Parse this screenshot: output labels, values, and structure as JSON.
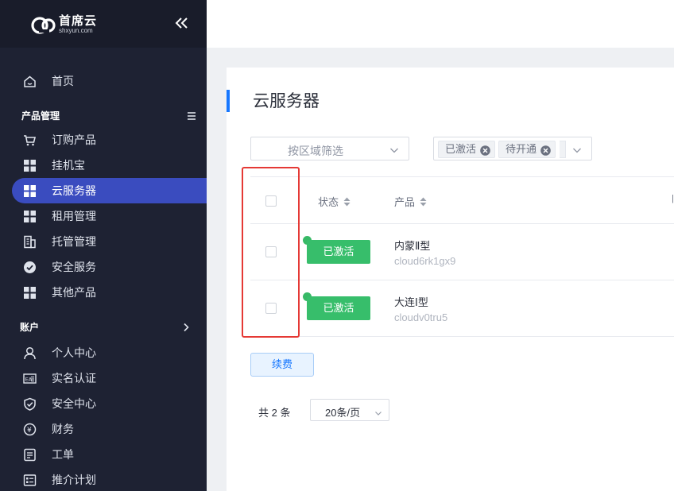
{
  "brand": {
    "name": "首席云",
    "sub": "shxyun.com"
  },
  "sidebar": {
    "home": "首页",
    "product_group": "产品管理",
    "products": [
      {
        "label": "订购产品",
        "icon": "cart-icon"
      },
      {
        "label": "挂机宝",
        "icon": "grid-icon"
      },
      {
        "label": "云服务器",
        "icon": "grid-icon",
        "active": true
      },
      {
        "label": "租用管理",
        "icon": "grid-icon"
      },
      {
        "label": "托管管理",
        "icon": "building-icon"
      },
      {
        "label": "安全服务",
        "icon": "check-circle-icon"
      },
      {
        "label": "其他产品",
        "icon": "grid-icon"
      }
    ],
    "account_group": "账户",
    "account": [
      {
        "label": "个人中心",
        "icon": "user-icon"
      },
      {
        "label": "实名认证",
        "icon": "id-card-icon"
      },
      {
        "label": "安全中心",
        "icon": "shield-icon"
      },
      {
        "label": "财务",
        "icon": "money-icon"
      },
      {
        "label": "工单",
        "icon": "ticket-icon"
      },
      {
        "label": "推介计划",
        "icon": "list-icon"
      }
    ]
  },
  "main": {
    "title": "云服务器",
    "region_filter_placeholder": "按区域筛选",
    "status_tags": [
      "已激活",
      "待开通"
    ],
    "columns": {
      "status": "状态",
      "product": "产品"
    },
    "rows": [
      {
        "status": "已激活",
        "product": "内蒙Ⅱ型",
        "id": "cloud6rk1gx9"
      },
      {
        "status": "已激活",
        "product": "大连Ⅰ型",
        "id": "cloudv0tru5"
      }
    ],
    "renew_button": "续费",
    "total": "共 2 条",
    "page_size": "20条/页"
  },
  "colors": {
    "sidebar_bg": "#1e2233",
    "active_item": "#3a4cbf",
    "accent": "#1677ff",
    "status_green": "#37be6b",
    "highlight": "#e53935"
  }
}
